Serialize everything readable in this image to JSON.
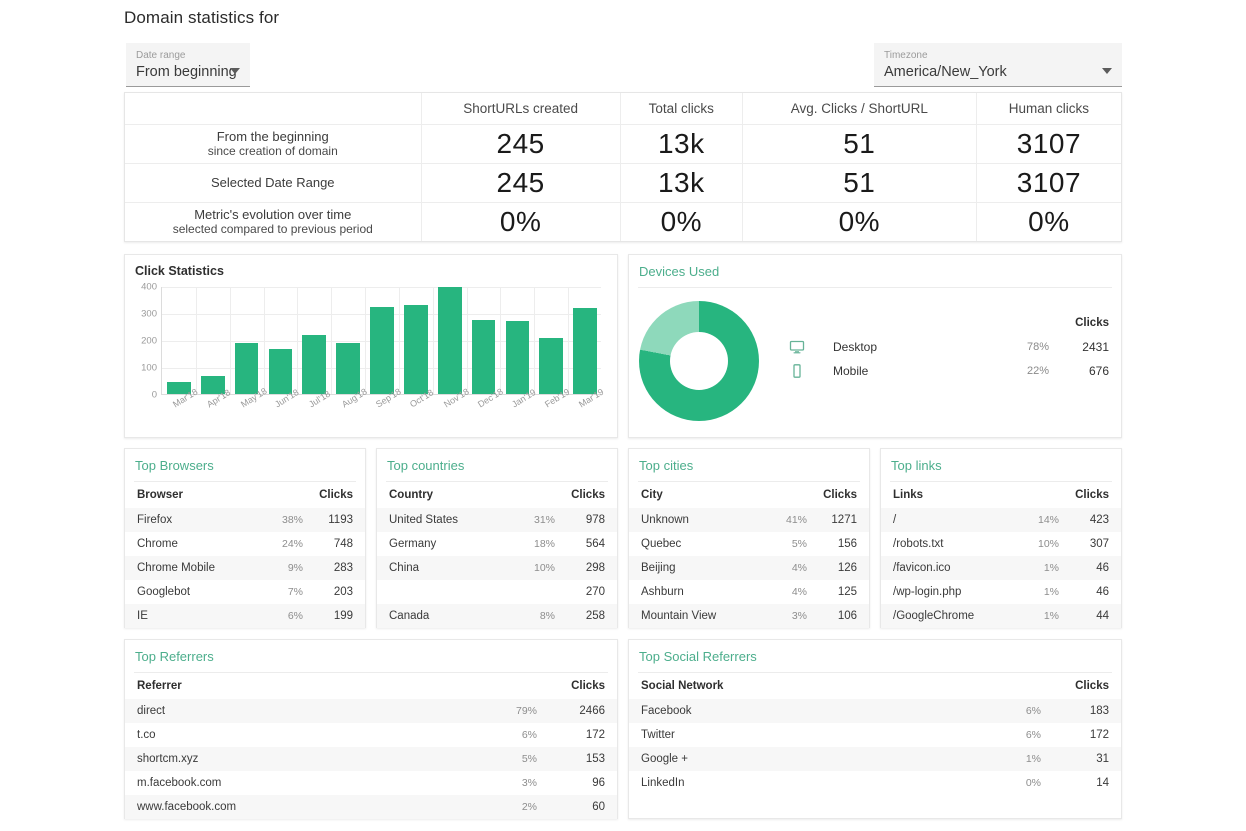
{
  "header": {
    "title": "Domain statistics for",
    "date_range": {
      "label": "Date range",
      "value": "From beginning"
    },
    "timezone": {
      "label": "Timezone",
      "value": "America/New_York"
    }
  },
  "summary": {
    "columns": [
      "",
      "ShortURLs created",
      "Total clicks",
      "Avg. Clicks / ShortURL",
      "Human clicks"
    ],
    "rows": [
      {
        "label_main": "From the beginning",
        "label_sub": "since creation of domain",
        "values": [
          "245",
          "13k",
          "51",
          "3107"
        ]
      },
      {
        "label_main": "Selected Date Range",
        "label_sub": "",
        "values": [
          "245",
          "13k",
          "51",
          "3107"
        ]
      },
      {
        "label_main": "Metric's evolution over time",
        "label_sub": "selected compared to previous period",
        "values": [
          "0%",
          "0%",
          "0%",
          "0%"
        ]
      }
    ]
  },
  "chart_data": {
    "type": "bar",
    "title": "Click Statistics",
    "xlabel": "",
    "ylabel": "",
    "ylim": [
      0,
      400
    ],
    "yticks": [
      0,
      100,
      200,
      300,
      400
    ],
    "grid": true,
    "legend": "none",
    "bar_color": "#27b57f",
    "categories": [
      "Mar'18",
      "Apr'18",
      "May'18",
      "Jun'18",
      "Jul'18",
      "Aug'18",
      "Sep'18",
      "Oct'18",
      "Nov'18",
      "Dec'18",
      "Jan'19",
      "Feb'19",
      "Mar'19"
    ],
    "values": [
      45,
      68,
      188,
      166,
      220,
      188,
      323,
      328,
      396,
      273,
      271,
      208,
      319
    ]
  },
  "devices": {
    "title": "Devices Used",
    "clicks_header": "Clicks",
    "colors": {
      "primary": "#27b57f",
      "secondary": "#8ed9bb"
    },
    "rows": [
      {
        "icon": "desktop-icon",
        "name": "Desktop",
        "pct": "78%",
        "clicks": "2431"
      },
      {
        "icon": "mobile-icon",
        "name": "Mobile",
        "pct": "22%",
        "clicks": "676"
      }
    ]
  },
  "top_browsers": {
    "title": "Top Browsers",
    "columns": [
      "Browser",
      "Clicks"
    ],
    "rows": [
      {
        "name": "Firefox",
        "pct": "38%",
        "clicks": "1193"
      },
      {
        "name": "Chrome",
        "pct": "24%",
        "clicks": "748"
      },
      {
        "name": "Chrome Mobile",
        "pct": "9%",
        "clicks": "283"
      },
      {
        "name": "Googlebot",
        "pct": "7%",
        "clicks": "203"
      },
      {
        "name": "IE",
        "pct": "6%",
        "clicks": "199"
      }
    ]
  },
  "top_countries": {
    "title": "Top countries",
    "columns": [
      "Country",
      "Clicks"
    ],
    "rows": [
      {
        "name": "United States",
        "pct": "31%",
        "clicks": "978"
      },
      {
        "name": "Germany",
        "pct": "18%",
        "clicks": "564"
      },
      {
        "name": "China",
        "pct": "10%",
        "clicks": "298"
      },
      {
        "name": "",
        "pct": "",
        "clicks": "270"
      },
      {
        "name": "Canada",
        "pct": "8%",
        "clicks": "258"
      }
    ]
  },
  "top_cities": {
    "title": "Top cities",
    "columns": [
      "City",
      "Clicks"
    ],
    "rows": [
      {
        "name": "Unknown",
        "pct": "41%",
        "clicks": "1271"
      },
      {
        "name": "Quebec",
        "pct": "5%",
        "clicks": "156"
      },
      {
        "name": "Beijing",
        "pct": "4%",
        "clicks": "126"
      },
      {
        "name": "Ashburn",
        "pct": "4%",
        "clicks": "125"
      },
      {
        "name": "Mountain View",
        "pct": "3%",
        "clicks": "106"
      }
    ]
  },
  "top_links": {
    "title": "Top links",
    "columns": [
      "Links",
      "Clicks"
    ],
    "rows": [
      {
        "name": "/",
        "pct": "14%",
        "clicks": "423"
      },
      {
        "name": "/robots.txt",
        "pct": "10%",
        "clicks": "307"
      },
      {
        "name": "/favicon.ico",
        "pct": "1%",
        "clicks": "46"
      },
      {
        "name": "/wp-login.php",
        "pct": "1%",
        "clicks": "46"
      },
      {
        "name": "/GoogleChrome",
        "pct": "1%",
        "clicks": "44"
      }
    ]
  },
  "top_referrers": {
    "title": "Top Referrers",
    "columns": [
      "Referrer",
      "Clicks"
    ],
    "rows": [
      {
        "name": "direct",
        "pct": "79%",
        "clicks": "2466"
      },
      {
        "name": "t.co",
        "pct": "6%",
        "clicks": "172"
      },
      {
        "name": "shortcm.xyz",
        "pct": "5%",
        "clicks": "153"
      },
      {
        "name": "m.facebook.com",
        "pct": "3%",
        "clicks": "96"
      },
      {
        "name": "www.facebook.com",
        "pct": "2%",
        "clicks": "60"
      }
    ]
  },
  "top_social": {
    "title": "Top Social Referrers",
    "columns": [
      "Social Network",
      "Clicks"
    ],
    "rows": [
      {
        "name": "Facebook",
        "pct": "6%",
        "clicks": "183"
      },
      {
        "name": "Twitter",
        "pct": "6%",
        "clicks": "172"
      },
      {
        "name": "Google +",
        "pct": "1%",
        "clicks": "31"
      },
      {
        "name": "LinkedIn",
        "pct": "0%",
        "clicks": "14"
      }
    ]
  }
}
